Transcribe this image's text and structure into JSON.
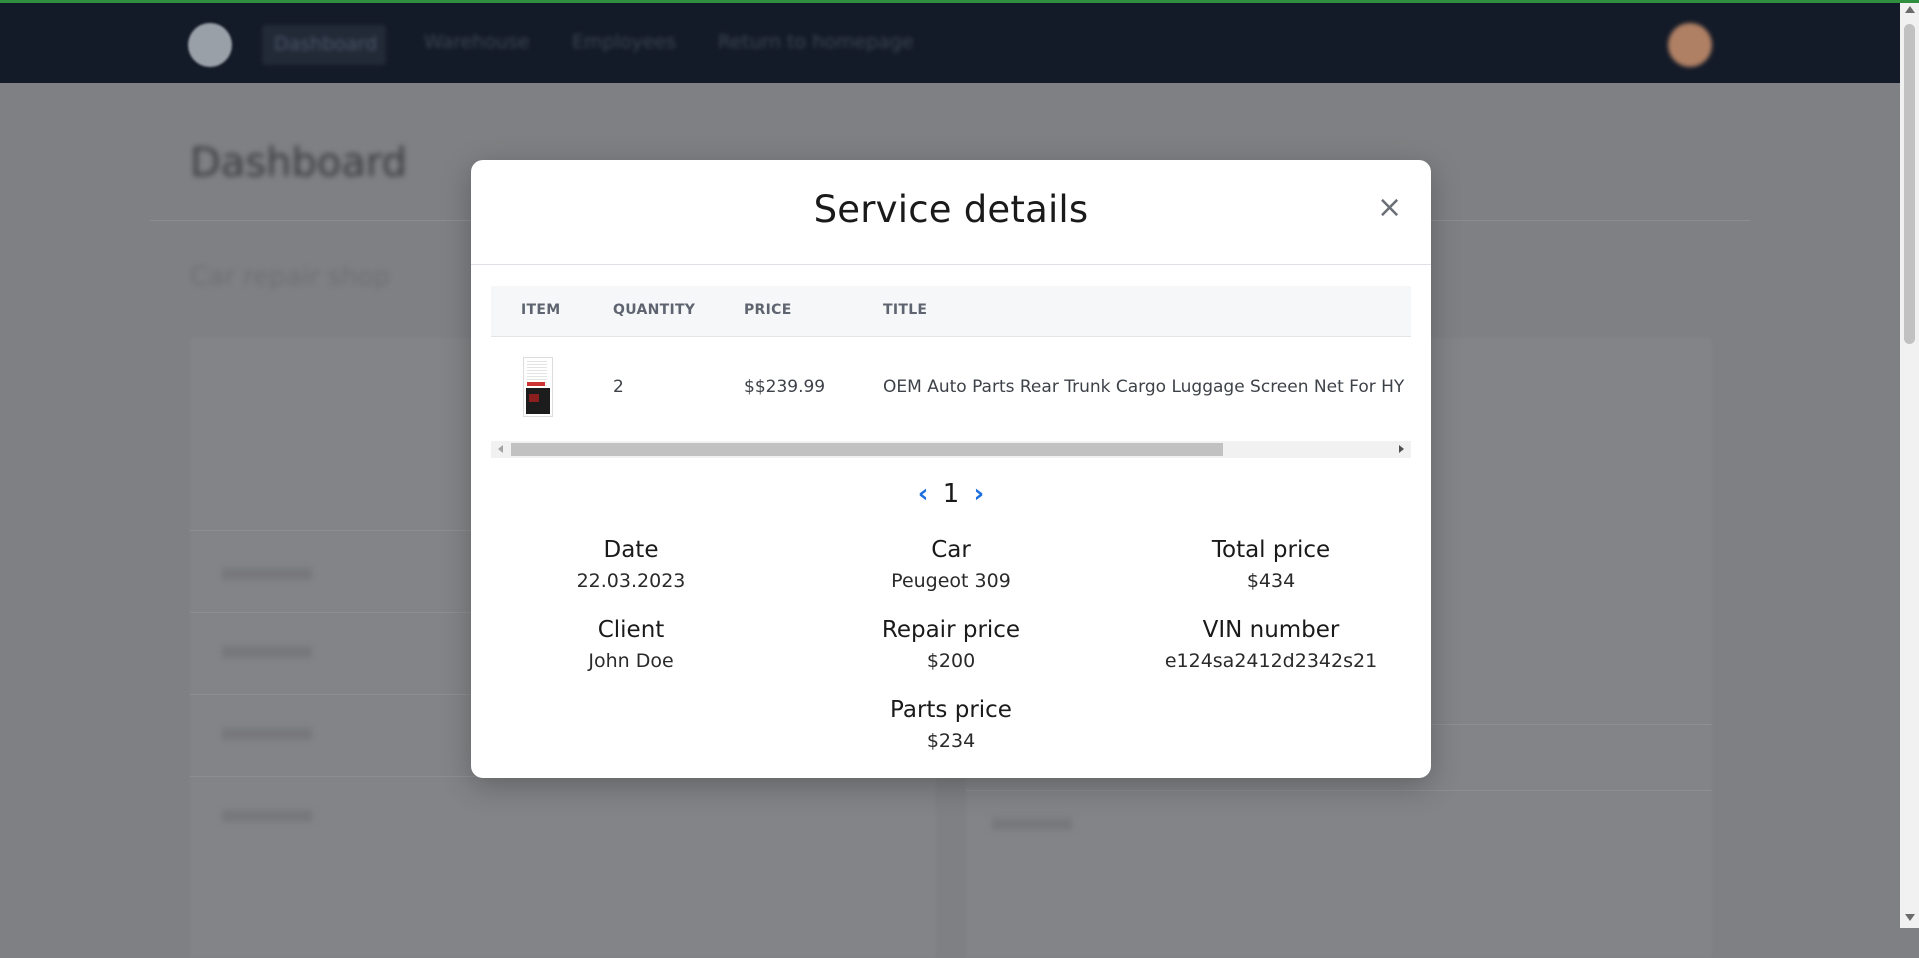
{
  "background": {
    "nav": [
      "Dashboard",
      "Warehouse",
      "Employees",
      "Return to homepage"
    ],
    "page_title": "Dashboard",
    "subtitle": "Car repair shop"
  },
  "modal": {
    "title": "Service details",
    "close_symbol": "×",
    "table": {
      "headers": [
        "ITEM",
        "QUANTITY",
        "PRICE",
        "TITLE"
      ],
      "rows": [
        {
          "quantity": "2",
          "price": "$$239.99",
          "title": "OEM Auto Parts Rear Trunk Cargo Luggage Screen Net For HY"
        }
      ]
    },
    "pager": {
      "prev": "‹",
      "page": "1",
      "next": "›"
    },
    "details": {
      "date": {
        "label": "Date",
        "value": "22.03.2023"
      },
      "car": {
        "label": "Car",
        "value": "Peugeot 309"
      },
      "total_price": {
        "label": "Total price",
        "value": "$434"
      },
      "client": {
        "label": "Client",
        "value": "John Doe"
      },
      "repair_price": {
        "label": "Repair price",
        "value": "$200"
      },
      "vin": {
        "label": "VIN number",
        "value": "e124sa2412d2342s21"
      },
      "parts_price": {
        "label": "Parts price",
        "value": "$234"
      }
    }
  },
  "colors": {
    "navbar": "#141b28",
    "overlay": "#7f8083",
    "accent": "#1e6fe0",
    "top_line": "#2f8f3e"
  }
}
